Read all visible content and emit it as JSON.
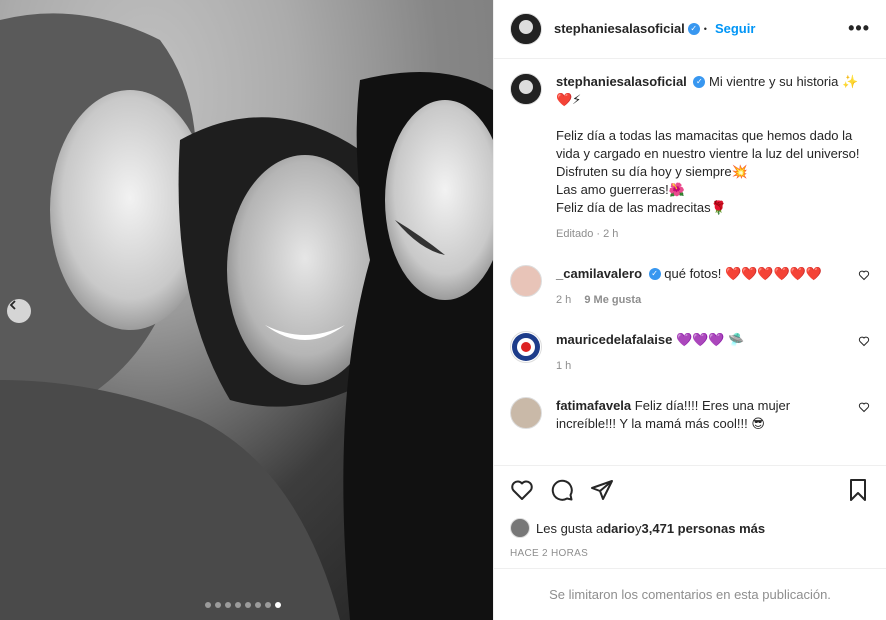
{
  "header": {
    "username": "stephaniesalasoficial",
    "separator": "•",
    "follow_label": "Seguir",
    "more_label": "•••"
  },
  "caption": {
    "username": "stephaniesalasoficial",
    "title_text": "Mi vientre y su historia ✨",
    "title_emojis": "❤️⚡",
    "body": "Feliz día a todas las mamacitas que hemos dado la vida y cargado en nuestro vientre la luz del universo!\nDisfruten su día hoy y siempre💥\nLas amo guerreras!🌺\nFeliz día de las madrecitas🌹",
    "meta": "Editado · 2 h"
  },
  "comments": [
    {
      "username": "_camilavalero",
      "verified": true,
      "text": "qué fotos! ",
      "emojis": "❤️❤️❤️❤️❤️❤️",
      "time": "2 h",
      "likes": "9 Me gusta"
    },
    {
      "username": "mauricedelafalaise",
      "verified": false,
      "text": "",
      "emojis": "💜💜💜",
      "extra_emoji": "🛸",
      "time": "1 h",
      "likes": ""
    },
    {
      "username": "fatimafavela",
      "verified": false,
      "text": "Feliz día!!!! Eres una mujer increíble!!! Y la mamá más cool!!! 😎",
      "emojis": "",
      "time": "",
      "likes": ""
    }
  ],
  "likes": {
    "prefix": "Les gusta a ",
    "user": "dario",
    "mid": " y ",
    "count": "3,471 personas más"
  },
  "posted_ago": "HACE 2 HORAS",
  "limited_notice": "Se limitaron los comentarios en esta publicación.",
  "carousel": {
    "total": 8,
    "active_index": 7
  },
  "colors": {
    "accent": "#0095f6",
    "verified": "#3897f0",
    "muted": "#8e8e8e",
    "heart": "#ed4956"
  },
  "icons": [
    "verified-icon",
    "more-icon",
    "heart-icon",
    "comment-icon",
    "share-icon",
    "save-icon",
    "chevron-left-icon"
  ]
}
